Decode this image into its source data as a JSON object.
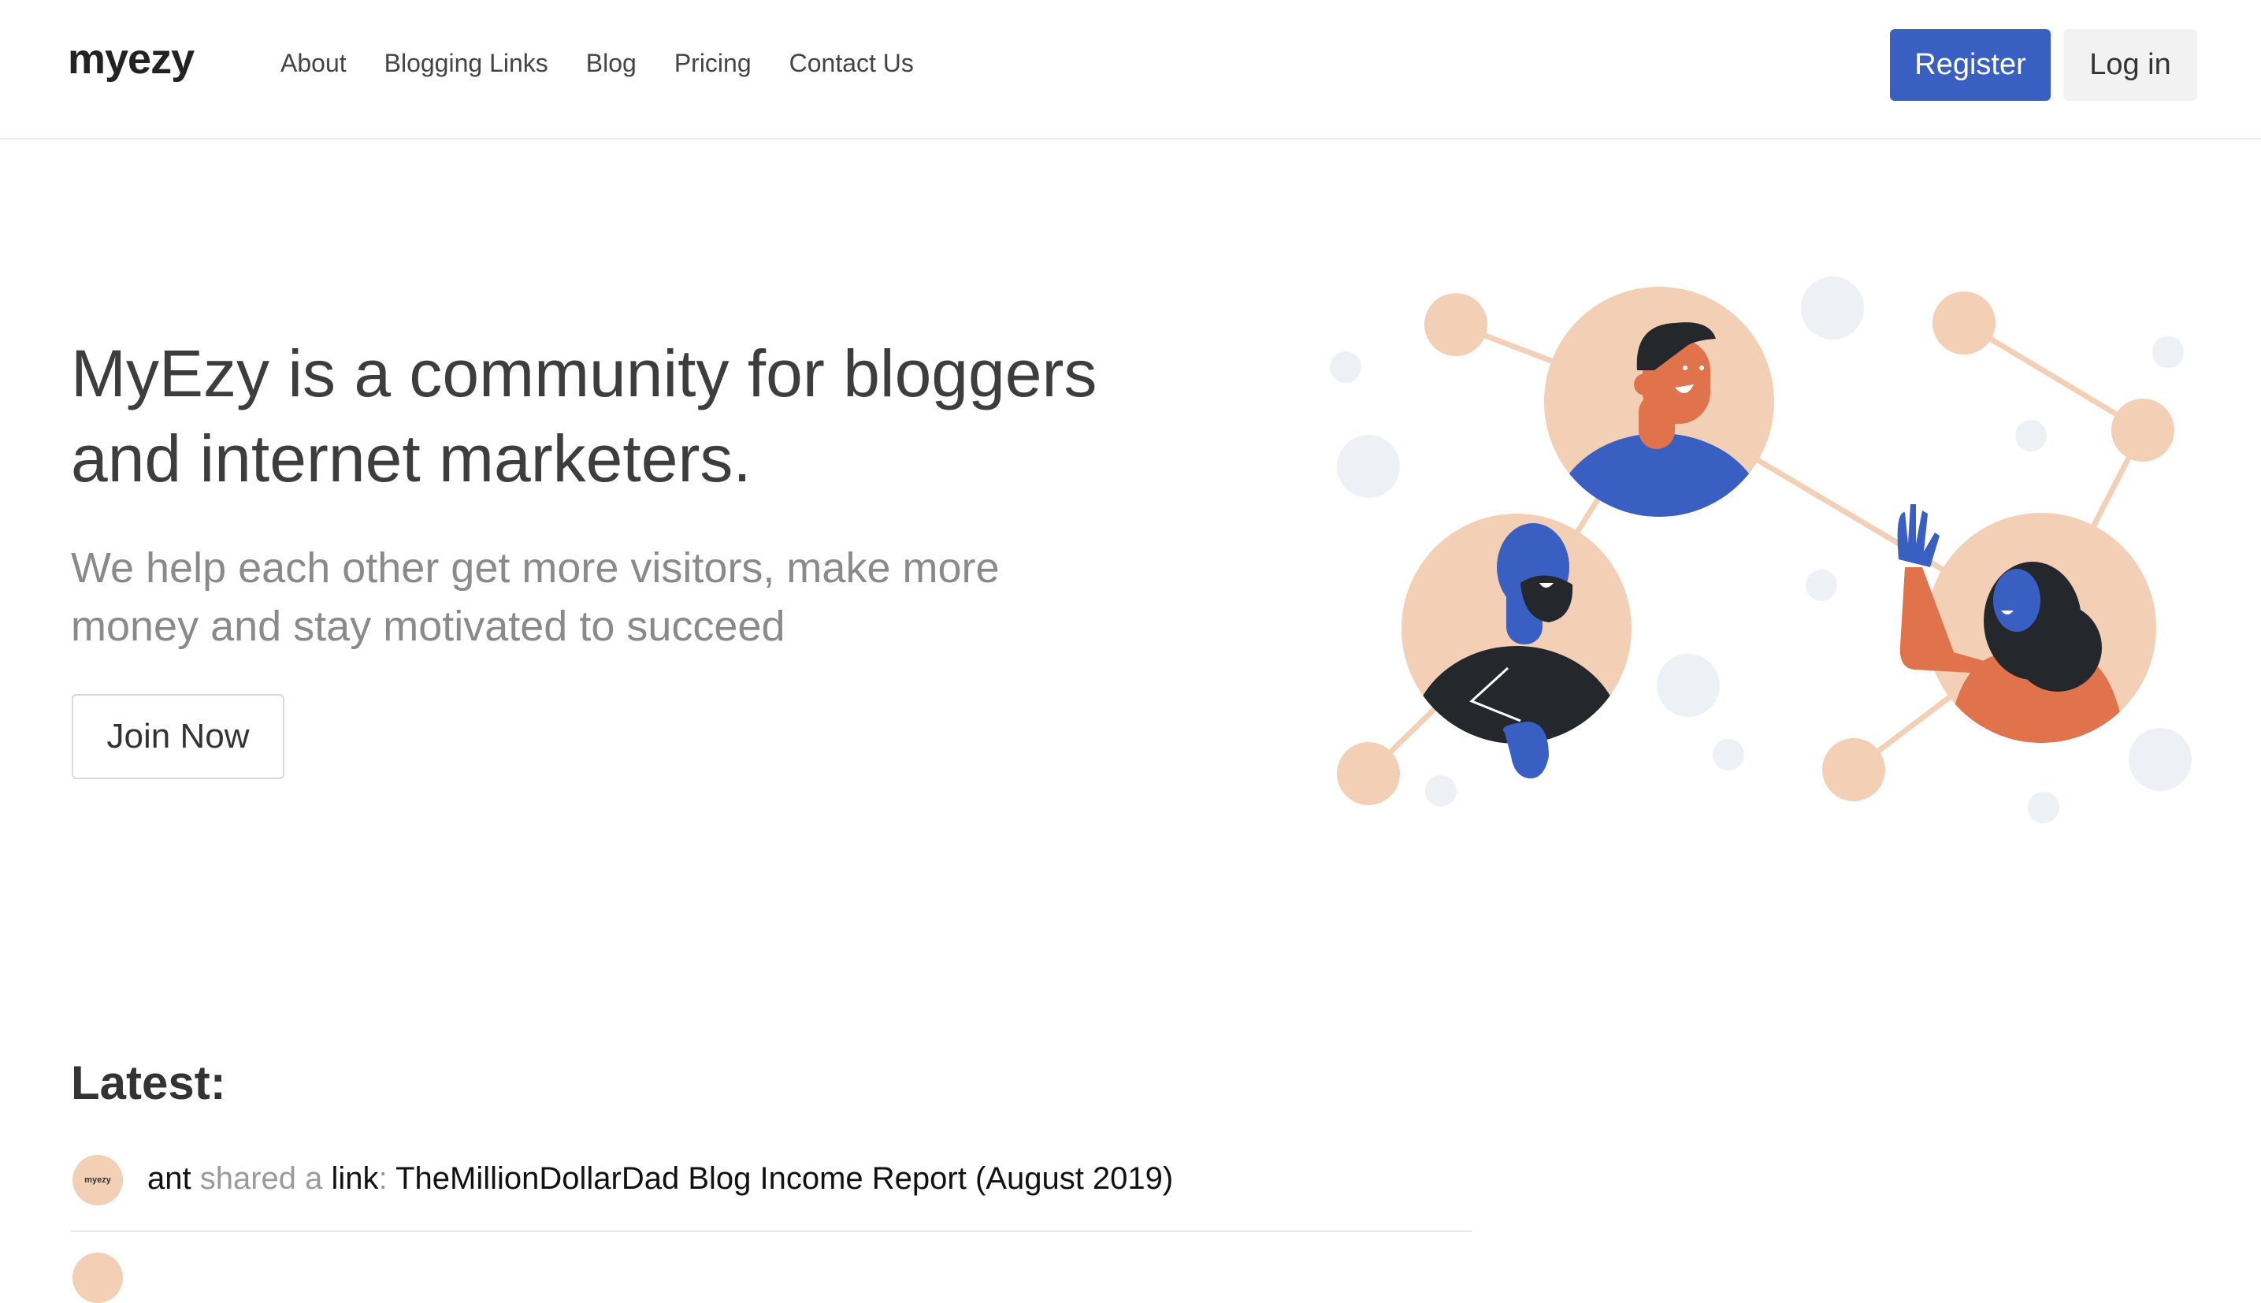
{
  "brand": {
    "logo": "myezy"
  },
  "nav": {
    "items": [
      {
        "label": "About"
      },
      {
        "label": "Blogging Links"
      },
      {
        "label": "Blog"
      },
      {
        "label": "Pricing"
      },
      {
        "label": "Contact Us"
      }
    ]
  },
  "auth": {
    "register_label": "Register",
    "login_label": "Log in"
  },
  "hero": {
    "title": "MyEzy is a community for bloggers and internet marketers.",
    "subtitle": "We help each other get more visitors, make more money and stay motivated to succeed",
    "cta_label": "Join Now"
  },
  "latest": {
    "heading": "Latest:",
    "items": [
      {
        "avatar_text": "myezy",
        "user": "ant",
        "action": "shared a",
        "type": "link",
        "colon": ":",
        "link_text": "TheMillionDollarDad Blog Income Report (August 2019)"
      }
    ]
  },
  "colors": {
    "primary": "#3a5fc3",
    "peach": "#f3cfb6",
    "orange": "#e0724c",
    "dark": "#24272b"
  }
}
